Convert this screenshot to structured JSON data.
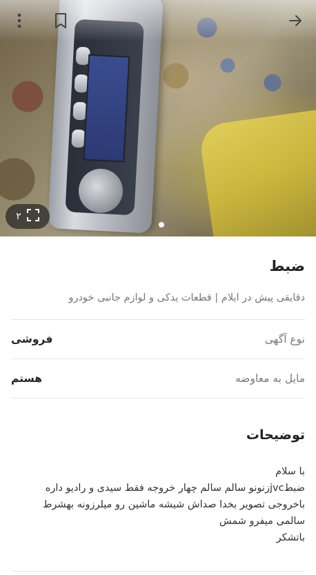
{
  "hero": {
    "photo_count": "۲",
    "icons": {
      "back": "arrow-forward-icon",
      "bookmark": "bookmark-icon",
      "more": "more-vertical-icon",
      "fullscreen": "fullscreen-icon"
    }
  },
  "ad": {
    "title": "ضبط",
    "subtitle": "دقایقی پیش در ایلام | قطعات یدکی و لوازم جانبی خودرو",
    "details": [
      {
        "label": "نوع آگهی",
        "value": "فروشی"
      },
      {
        "label": "مایل به معاوضه",
        "value": "هستم"
      }
    ],
    "description_title": "توضیحات",
    "description": "با سلام\nضبطjvcزنونو سالم سالم چهار خروجه  فقط سیدی و رادیو داره\nباخروجی تصویر بخدا صداش شیشه ماشین رو میلرزونه  بهشرط\nسالمی میفرو شمش\nباتشکر"
  },
  "colors": {
    "title": "#222222",
    "muted": "#777777",
    "divider": "#e6e6e6"
  }
}
